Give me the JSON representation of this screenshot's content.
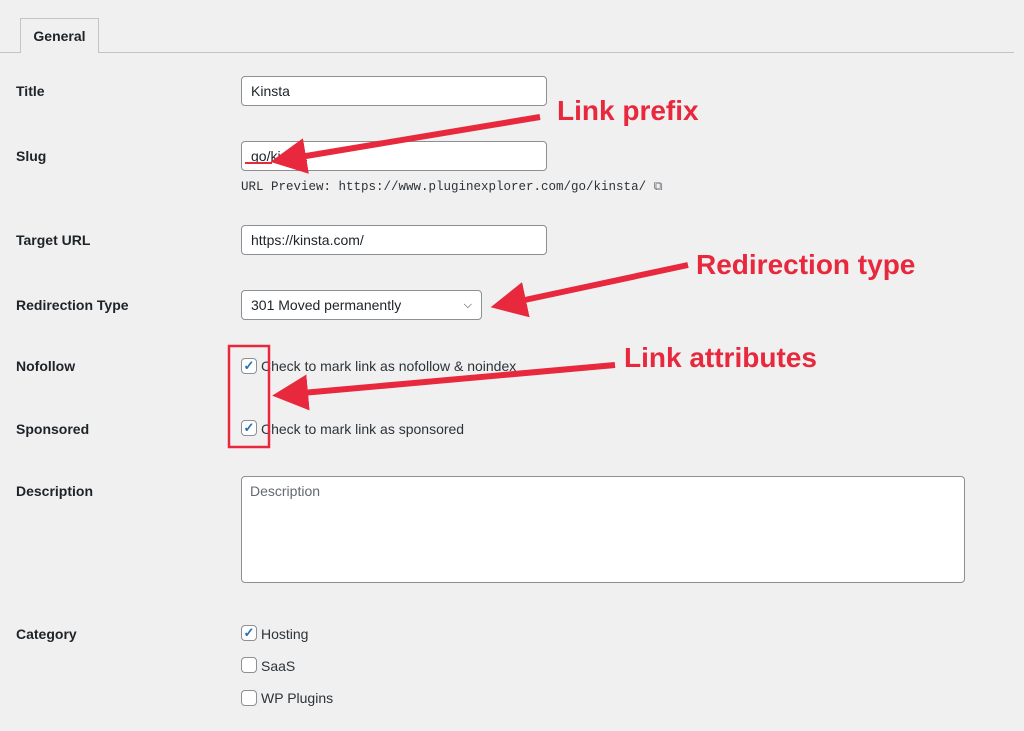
{
  "tabs": [
    {
      "label": "General"
    }
  ],
  "form": {
    "title": {
      "label": "Title",
      "value": "Kinsta"
    },
    "slug": {
      "label": "Slug",
      "value": "go/kinsta",
      "preview": "URL Preview: https://www.pluginexplorer.com/go/kinsta/"
    },
    "target_url": {
      "label": "Target URL",
      "value": "https://kinsta.com/"
    },
    "redirection_type": {
      "label": "Redirection Type",
      "value": "301 Moved permanently"
    },
    "nofollow": {
      "label": "Nofollow",
      "text": "Check to mark link as nofollow & noindex",
      "checked": true
    },
    "sponsored": {
      "label": "Sponsored",
      "text": "Check to mark link as sponsored",
      "checked": true
    },
    "description": {
      "label": "Description",
      "placeholder": "Description"
    },
    "category": {
      "label": "Category",
      "options": [
        {
          "label": "Hosting",
          "checked": true
        },
        {
          "label": "SaaS",
          "checked": false
        },
        {
          "label": "WP Plugins",
          "checked": false
        }
      ]
    }
  },
  "annotations": {
    "link_prefix": "Link prefix",
    "redirection_type": "Redirection type",
    "link_attributes": "Link attributes",
    "color": "#e8283c"
  }
}
